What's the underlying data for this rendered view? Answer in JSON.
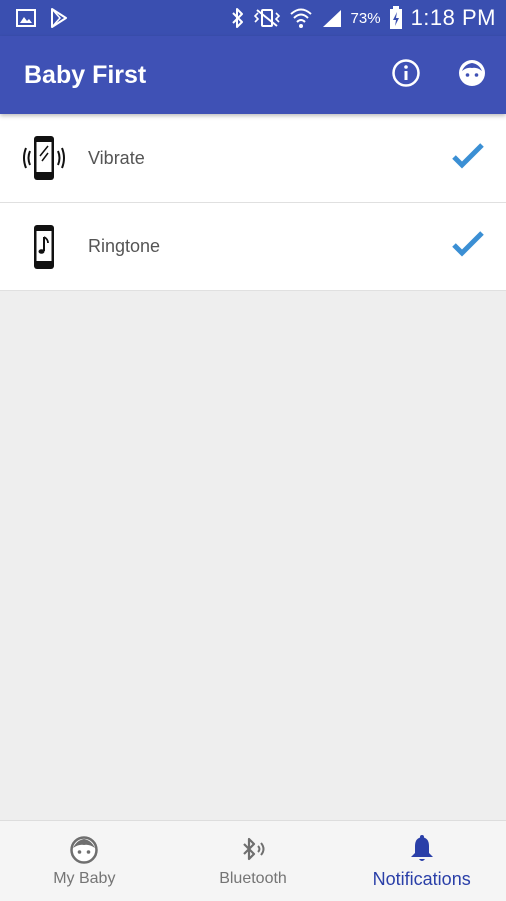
{
  "status_bar": {
    "battery_percent": "73%",
    "time": "1:18 PM",
    "icons": [
      "gallery-icon",
      "play-store-icon",
      "bluetooth-icon",
      "vibrate-mode-icon",
      "wifi-icon",
      "signal-icon",
      "battery-charging-icon"
    ]
  },
  "app_bar": {
    "title": "Baby First",
    "actions": [
      {
        "icon": "info-icon"
      },
      {
        "icon": "baby-face-icon"
      }
    ]
  },
  "settings": {
    "items": [
      {
        "label": "Vibrate",
        "icon": "vibrate-phone-icon",
        "checked": true
      },
      {
        "label": "Ringtone",
        "icon": "ringtone-phone-icon",
        "checked": true
      }
    ]
  },
  "bottom_nav": {
    "items": [
      {
        "label": "My Baby",
        "icon": "baby-face-icon",
        "active": false
      },
      {
        "label": "Bluetooth",
        "icon": "bluetooth-icon",
        "active": false
      },
      {
        "label": "Notifications",
        "icon": "bell-icon",
        "active": true
      }
    ]
  },
  "colors": {
    "primary": "#3f51b5",
    "status_bar": "#3a4fb0",
    "check": "#3b8fd4",
    "background": "#eeeeee",
    "active_nav": "#2a3fa8"
  }
}
